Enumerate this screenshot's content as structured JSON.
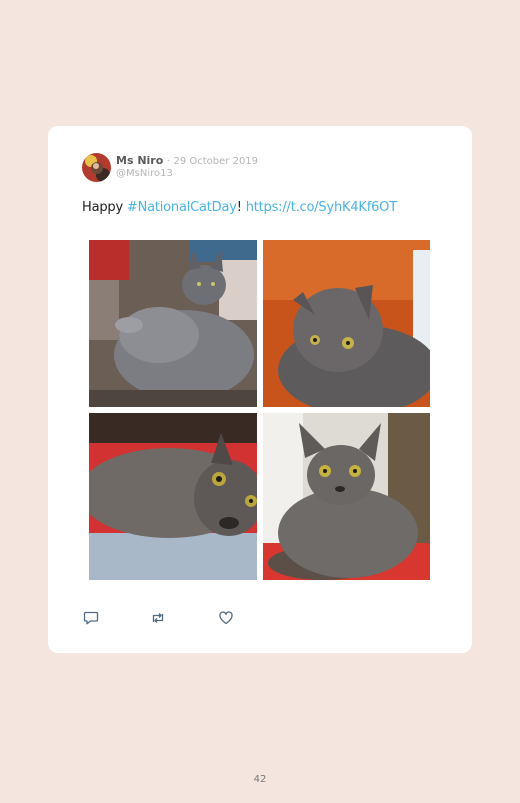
{
  "tweet": {
    "author_name": "Ms Niro",
    "separator": "·",
    "date": "29 October 2019",
    "handle": "@MsNiro13",
    "text_prefix": "Happy ",
    "hashtag": "#NationalCatDay",
    "text_mid": "! ",
    "link": "https://t.co/SyhK4Kf6OT",
    "photos": [
      {
        "subject": "grey-cat-lying-on-back"
      },
      {
        "subject": "grey-cat-on-orange-blanket"
      },
      {
        "subject": "grey-cat-lying-closeup"
      },
      {
        "subject": "grey-cat-sitting-on-red-blanket"
      }
    ],
    "actions": {
      "reply_icon": "reply-icon",
      "retweet_icon": "retweet-icon",
      "like_icon": "heart-icon"
    },
    "colors": {
      "link": "#4ab3e4",
      "background": "#f4e6df",
      "card": "#ffffff"
    }
  },
  "page_number": "42"
}
